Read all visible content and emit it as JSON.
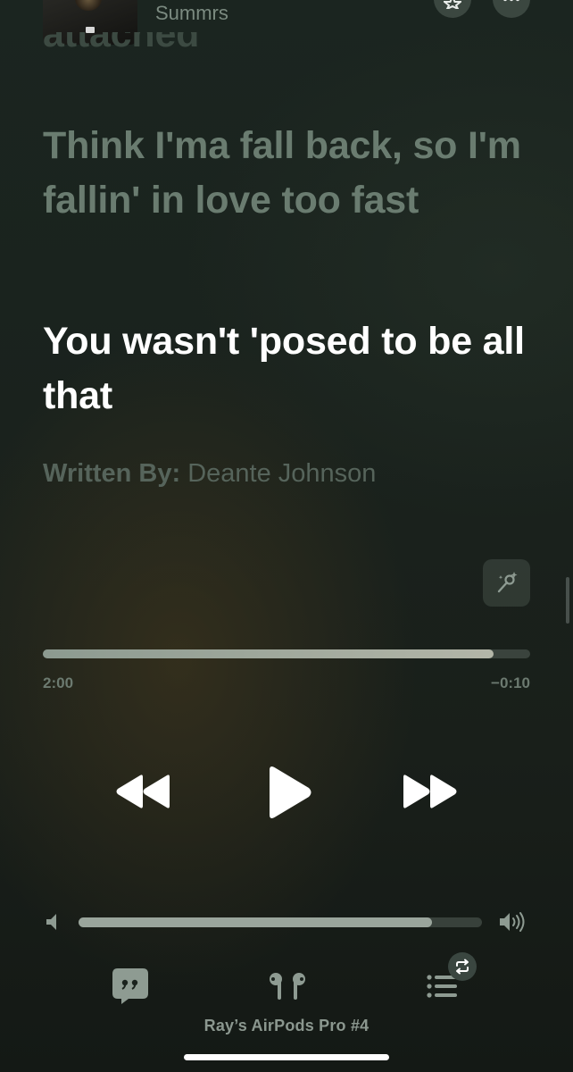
{
  "header": {
    "artist": "Summrs",
    "favorite_icon": "star-icon",
    "more_icon": "ellipsis-icon"
  },
  "lyrics": {
    "previous_line": "attached",
    "past_line": "Think I'ma fall back, so I'm fallin' in love too fast",
    "current_line": "You wasn't 'posed to be all that",
    "credits_label": "Written By:",
    "credits_value": "Deante Johnson"
  },
  "playback": {
    "elapsed": "2:00",
    "remaining": "−0:10",
    "progress_fraction": 0.924,
    "volume_fraction": 0.876
  },
  "footer": {
    "device": "Ray’s AirPods Pro #4"
  },
  "colors": {
    "current_lyric": "#ffffff",
    "dim_lyric": "#6a7c70"
  }
}
